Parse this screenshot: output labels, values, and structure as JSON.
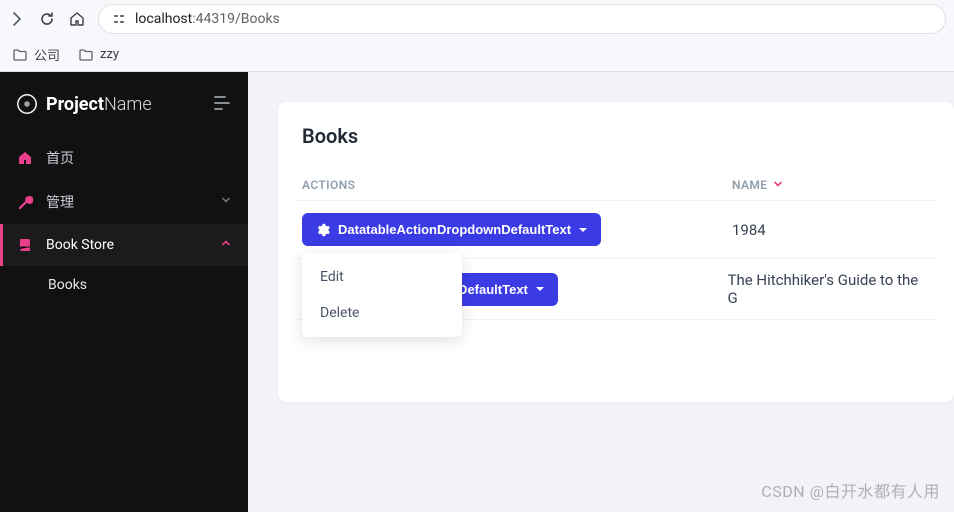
{
  "browser": {
    "url_host": "localhost",
    "url_port_path": ":44319/Books"
  },
  "bookmarks": {
    "company": "公司",
    "zzy": "zzy"
  },
  "brand": {
    "strong": "Project",
    "light": "Name"
  },
  "sidebar": {
    "home": "首页",
    "manage": "管理",
    "bookstore": "Book Store",
    "books": "Books"
  },
  "page": {
    "title": "Books"
  },
  "table": {
    "col_actions": "ACTIONS",
    "col_name": "NAME",
    "action_label": "DatatableActionDropdownDefaultText",
    "dropdown": {
      "edit": "Edit",
      "delete": "Delete"
    },
    "rows": [
      {
        "name": "1984"
      },
      {
        "name": "The Hitchhiker's Guide to the G"
      }
    ]
  },
  "watermark": "CSDN @白开水都有人用"
}
